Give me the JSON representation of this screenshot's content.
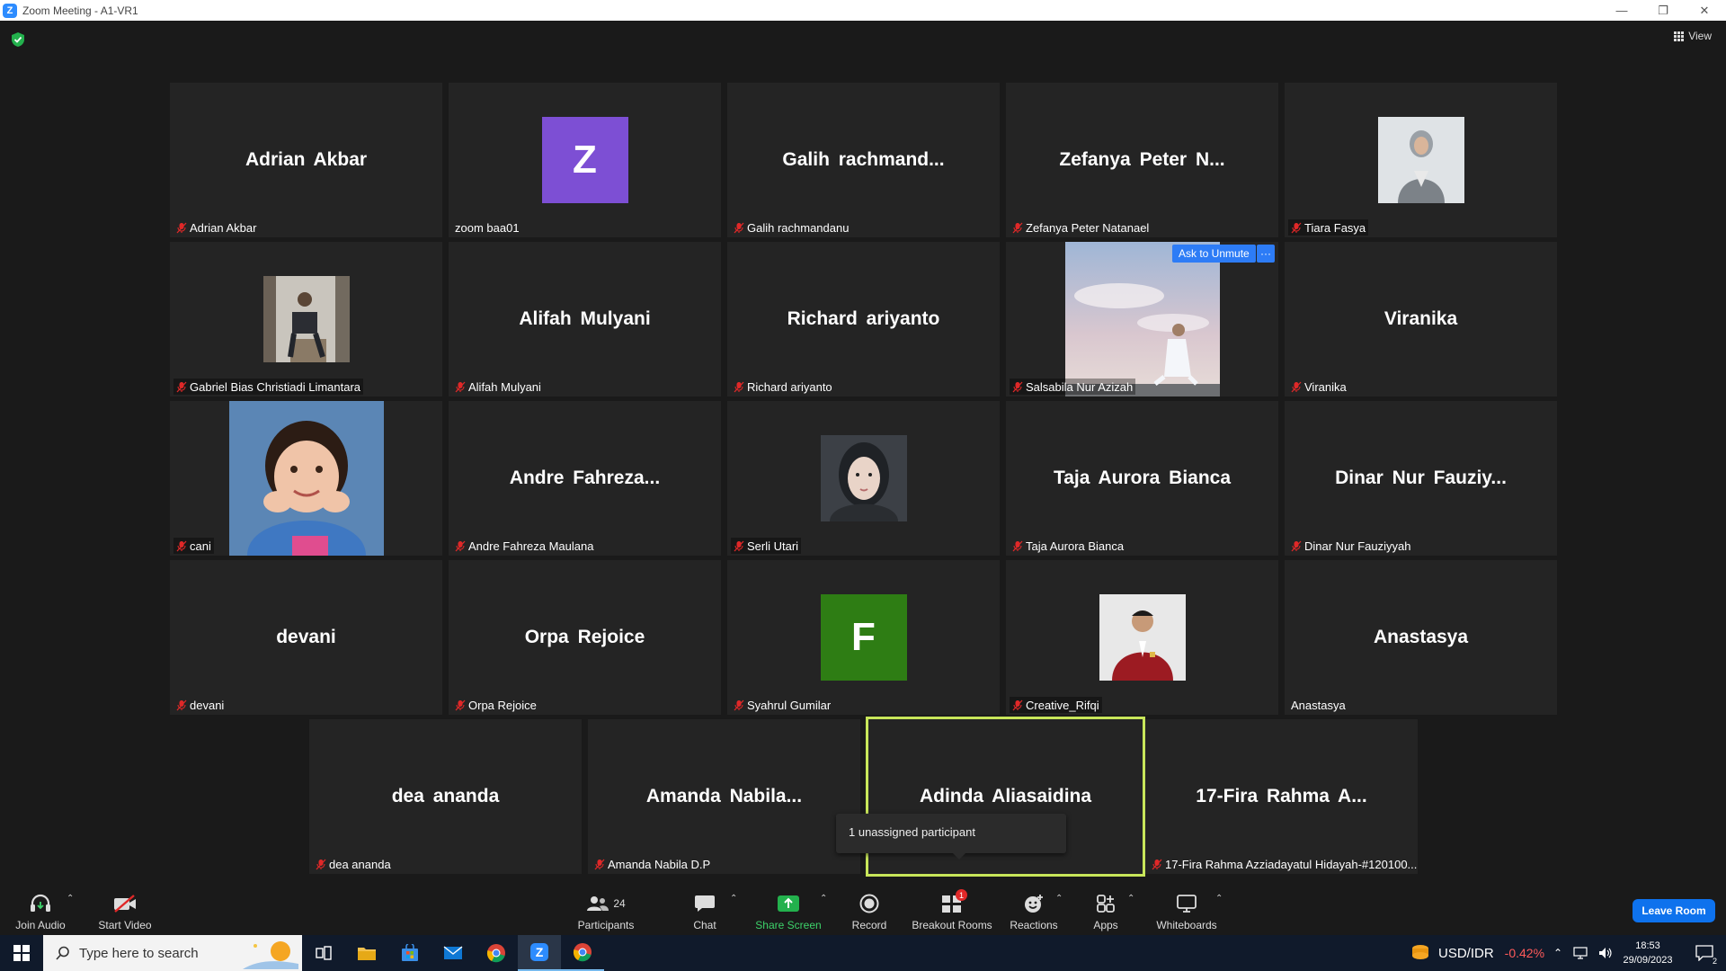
{
  "window": {
    "title": "Zoom Meeting - A1-VR1"
  },
  "view_button": {
    "label": "View"
  },
  "tiles": [
    {
      "big": "Adrian Akbar",
      "tag": "Adrian Akbar",
      "muted": true
    },
    {
      "big": "",
      "tag": "zoom baa01",
      "muted": false,
      "avatar_letter": "Z",
      "avatar_color": "#7d4fd4"
    },
    {
      "big": "Galih  rachmand...",
      "tag": "Galih rachmandanu",
      "muted": true
    },
    {
      "big": "Zefanya  Peter  N...",
      "tag": "Zefanya Peter Natanael",
      "muted": true
    },
    {
      "big": "",
      "tag": "Tiara Fasya",
      "muted": true,
      "photo": "woman-hijab-gray"
    },
    {
      "big": "",
      "tag": "Gabriel Bias Christiadi Limantara",
      "muted": true,
      "photo": "man-sitting"
    },
    {
      "big": "Alifah Mulyani",
      "tag": "Alifah Mulyani",
      "muted": true
    },
    {
      "big": "Richard ariyanto",
      "tag": "Richard ariyanto",
      "muted": true
    },
    {
      "big": "",
      "tag": "Salsabila Nur Azizah",
      "muted": true,
      "photo": "sky-person"
    },
    {
      "big": "Viranika",
      "tag": "Viranika",
      "muted": true
    },
    {
      "big": "",
      "tag": "cani",
      "muted": true,
      "photo": "child"
    },
    {
      "big": "Andre  Fahreza...",
      "tag": "Andre Fahreza Maulana",
      "muted": true
    },
    {
      "big": "",
      "tag": "Serli Utari",
      "muted": true,
      "photo": "woman-dark"
    },
    {
      "big": "Taja Aurora Bianca",
      "tag": "Taja Aurora Bianca",
      "muted": true
    },
    {
      "big": "Dinar  Nur  Fauziy...",
      "tag": "Dinar Nur Fauziyyah",
      "muted": true
    },
    {
      "big": "devani",
      "tag": "devani",
      "muted": true
    },
    {
      "big": "Orpa Rejoice",
      "tag": "Orpa Rejoice",
      "muted": true
    },
    {
      "big": "",
      "tag": "Syahrul Gumilar",
      "muted": true,
      "avatar_letter": "F",
      "avatar_color": "#2e7d14"
    },
    {
      "big": "",
      "tag": "Creative_Rifqi",
      "muted": true,
      "photo": "man-red-jacket"
    },
    {
      "big": "Anastasya",
      "tag": "Anastasya",
      "muted": false
    },
    {
      "big": "dea ananda",
      "tag": "dea ananda",
      "muted": true
    },
    {
      "big": "Amanda  Nabila...",
      "tag": "Amanda Nabila D.P",
      "muted": true
    },
    {
      "big": "Adinda Aliasaidina",
      "tag": "",
      "muted": false,
      "active_speaker": true
    },
    {
      "big": "17-Fira  Rahma  A...",
      "tag": "17-Fira Rahma Azziadayatul Hidayah-#120100...",
      "muted": true
    }
  ],
  "ask_to_unmute": "Ask to Unmute",
  "more_dots": "···",
  "tooltip": "1 unassigned participant",
  "toolbar": {
    "join_audio": "Join Audio",
    "start_video": "Start Video",
    "participants": "Participants",
    "participants_count": "24",
    "chat": "Chat",
    "share_screen": "Share Screen",
    "record": "Record",
    "breakout_rooms": "Breakout Rooms",
    "breakout_badge": "1",
    "reactions": "Reactions",
    "apps": "Apps",
    "whiteboards": "Whiteboards",
    "leave": "Leave Room"
  },
  "taskbar": {
    "search_placeholder": "Type here to search",
    "ticker_label": "USD/IDR",
    "ticker_change": "-0.42%",
    "time": "18:53",
    "date": "29/09/2023",
    "notif_count": "2"
  },
  "colors": {
    "accent": "#0e72ed",
    "speaker_border": "#c8e65a",
    "share_green": "#3dd26a",
    "mute_red": "#e02828",
    "ticker_red": "#ff5a5a"
  }
}
